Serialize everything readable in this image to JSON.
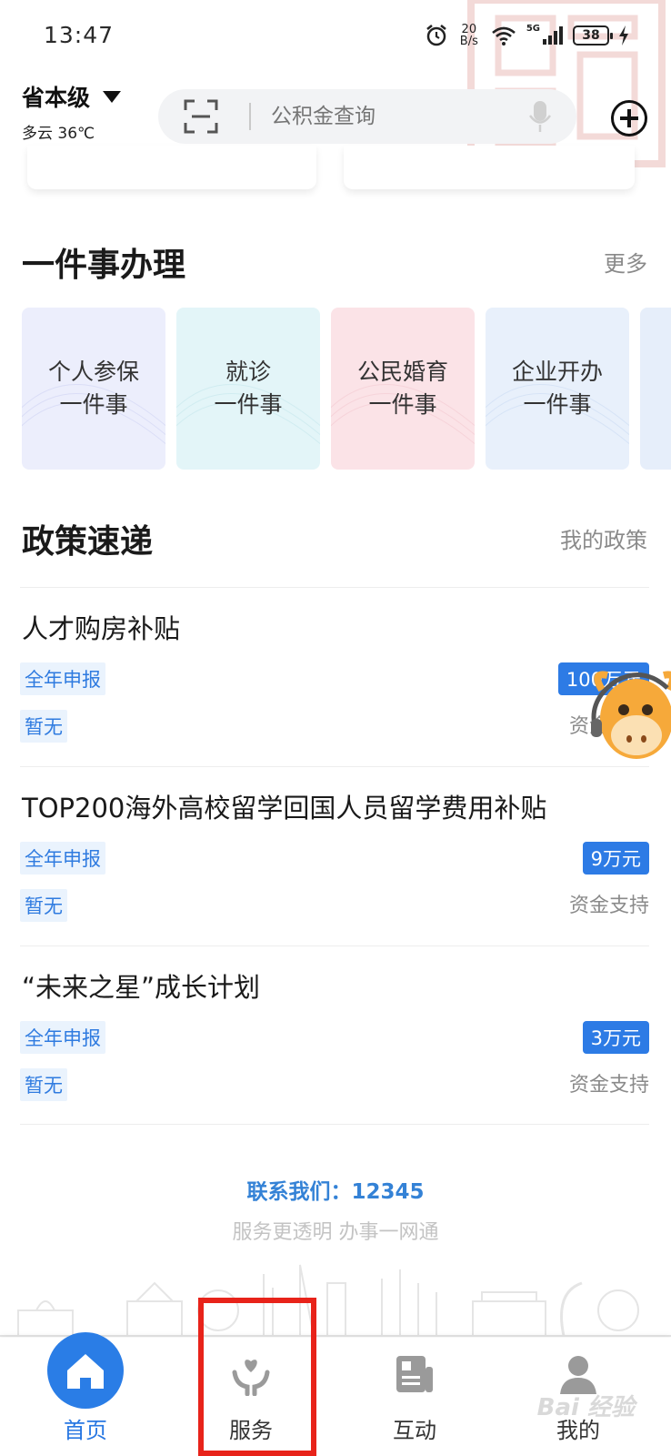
{
  "status_bar": {
    "time": "13:47",
    "net_speed_value": "20",
    "net_speed_unit": "B/s",
    "network": "5G",
    "battery": "38"
  },
  "header": {
    "region": "省本级",
    "weather": "多云 36℃",
    "search_placeholder": "公积金查询"
  },
  "one_thing": {
    "title": "一件事办理",
    "more": "更多",
    "cards": [
      {
        "label": "个人参保\n一件事",
        "color": "#eceefc"
      },
      {
        "label": "就诊\n一件事",
        "color": "#e3f5f8"
      },
      {
        "label": "公民婚育\n一件事",
        "color": "#fbe3e7"
      },
      {
        "label": "企业开办\n一件事",
        "color": "#e8f0fb"
      }
    ]
  },
  "policy": {
    "title": "政策速递",
    "my_policy": "我的政策",
    "items": [
      {
        "title": "人才购房补贴",
        "tag1": "全年申报",
        "tag2": "暂无",
        "amount": "100万元",
        "caption": "资金支持"
      },
      {
        "title": "TOP200海外高校留学回国人员留学费用补贴",
        "tag1": "全年申报",
        "tag2": "暂无",
        "amount": "9万元",
        "caption": "资金支持"
      },
      {
        "title": "“未来之星”成长计划",
        "tag1": "全年申报",
        "tag2": "暂无",
        "amount": "3万元",
        "caption": "资金支持"
      }
    ]
  },
  "footer": {
    "contact": "联系我们：12345",
    "slogan": "服务更透明 办事一网通"
  },
  "bottom_nav": [
    {
      "label": "首页",
      "icon": "home-icon",
      "active": true
    },
    {
      "label": "服务",
      "icon": "service-hand-heart-icon",
      "active": false
    },
    {
      "label": "互动",
      "icon": "news-icon",
      "active": false
    },
    {
      "label": "我的",
      "icon": "user-icon",
      "active": false
    }
  ],
  "watermark": "Bai 经验",
  "colors": {
    "accent": "#2a7de6",
    "highlight": "#e8231a",
    "tag_bg": "#eaf3fd"
  }
}
